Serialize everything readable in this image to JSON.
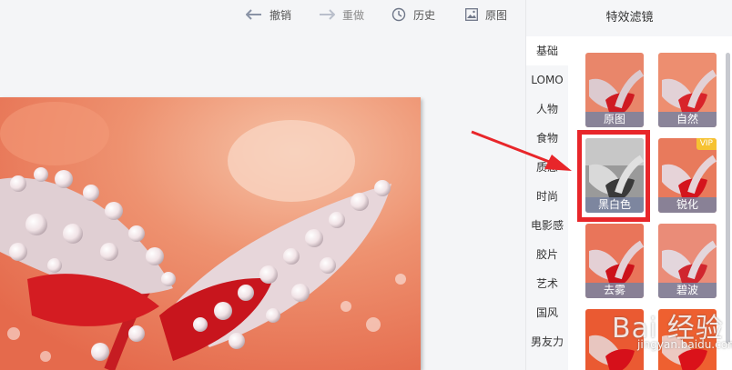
{
  "toolbar": {
    "undo_label": "撤销",
    "redo_label": "重做",
    "history_label": "历史",
    "original_label": "原图"
  },
  "panel": {
    "title": "特效滤镜",
    "categories": [
      {
        "label": "基础",
        "active": true
      },
      {
        "label": "LOMO"
      },
      {
        "label": "人物"
      },
      {
        "label": "食物"
      },
      {
        "label": "质感"
      },
      {
        "label": "时尚"
      },
      {
        "label": "电影感"
      },
      {
        "label": "胶片"
      },
      {
        "label": "艺术"
      },
      {
        "label": "国风"
      },
      {
        "label": "男友力"
      }
    ],
    "filters": [
      {
        "label": "原图"
      },
      {
        "label": "自然"
      },
      {
        "label": "黑白色",
        "selected": true
      },
      {
        "label": "锐化",
        "badge": "VIP"
      },
      {
        "label": "去雾"
      },
      {
        "label": "碧波"
      },
      {
        "label": ""
      },
      {
        "label": ""
      }
    ]
  },
  "watermark": {
    "text": "Bai 经验",
    "sub": "jingyan.baidu.com"
  },
  "colors": {
    "highlight": "#e8262a",
    "photo_bg": "#ea7a5a",
    "petal": "#d41c22"
  }
}
